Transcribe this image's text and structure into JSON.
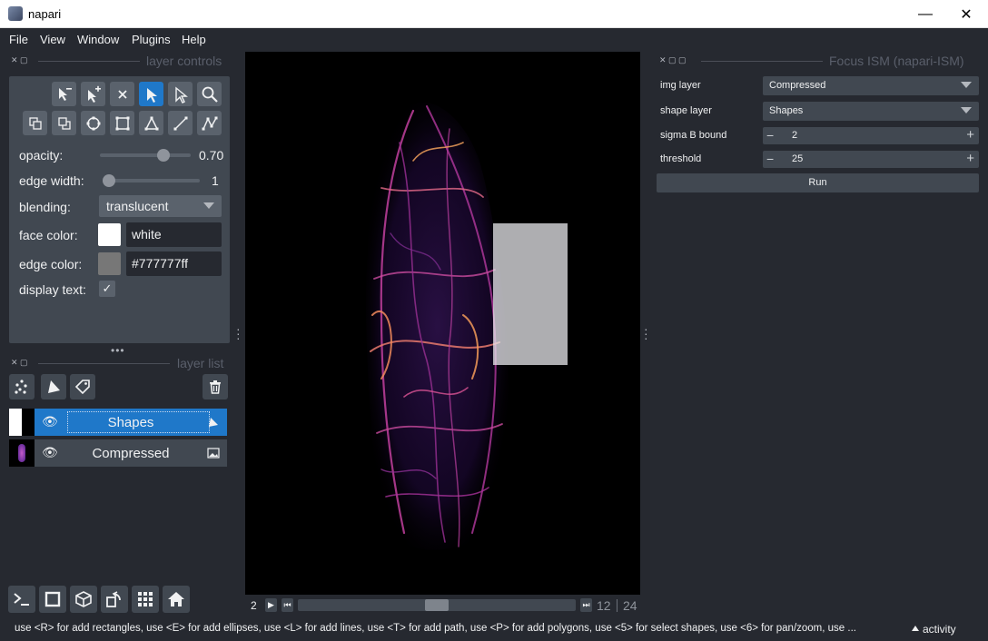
{
  "window": {
    "title": "napari",
    "minimize": "—",
    "maximize": "☐",
    "close": "✕"
  },
  "menu": [
    "File",
    "View",
    "Window",
    "Plugins",
    "Help"
  ],
  "layer_controls": {
    "title": "layer controls",
    "opacity_label": "opacity:",
    "opacity_value": "0.70",
    "opacity_fraction": 0.7,
    "edge_width_label": "edge width:",
    "edge_width_value": "1",
    "blending_label": "blending:",
    "blending_value": "translucent",
    "face_color_label": "face color:",
    "face_color_value": "white",
    "face_color_hex": "#ffffff",
    "edge_color_label": "edge color:",
    "edge_color_value": "#777777ff",
    "edge_color_hex": "#777777",
    "display_text_label": "display text:",
    "display_text_checked": "✓"
  },
  "layer_list": {
    "title": "layer list",
    "layers": [
      {
        "name": "Shapes",
        "selected": true,
        "type": "shapes"
      },
      {
        "name": "Compressed",
        "selected": false,
        "type": "image"
      }
    ]
  },
  "dims": {
    "axis_label": "2",
    "current": "12",
    "total": "24",
    "position_fraction": 0.5
  },
  "plugin": {
    "title": "Focus  ISM (napari-ISM)",
    "img_layer_label": "img layer",
    "img_layer_value": "Compressed",
    "shape_layer_label": "shape layer",
    "shape_layer_value": "Shapes",
    "sigma_label": "sigma B bound",
    "sigma_value": "2",
    "threshold_label": "threshold",
    "threshold_value": "25",
    "run_label": "Run"
  },
  "status": {
    "message": "use <R> for add rectangles, use <E> for add ellipses, use <L> for add lines, use <T> for add path, use <P> for add polygons, use <5> for select shapes, use <6> for pan/zoom, use ...",
    "activity": "activity"
  },
  "colors": {
    "accent": "#1f78c9",
    "bg": "#262930",
    "panel": "#414851",
    "button": "#5a626c"
  }
}
